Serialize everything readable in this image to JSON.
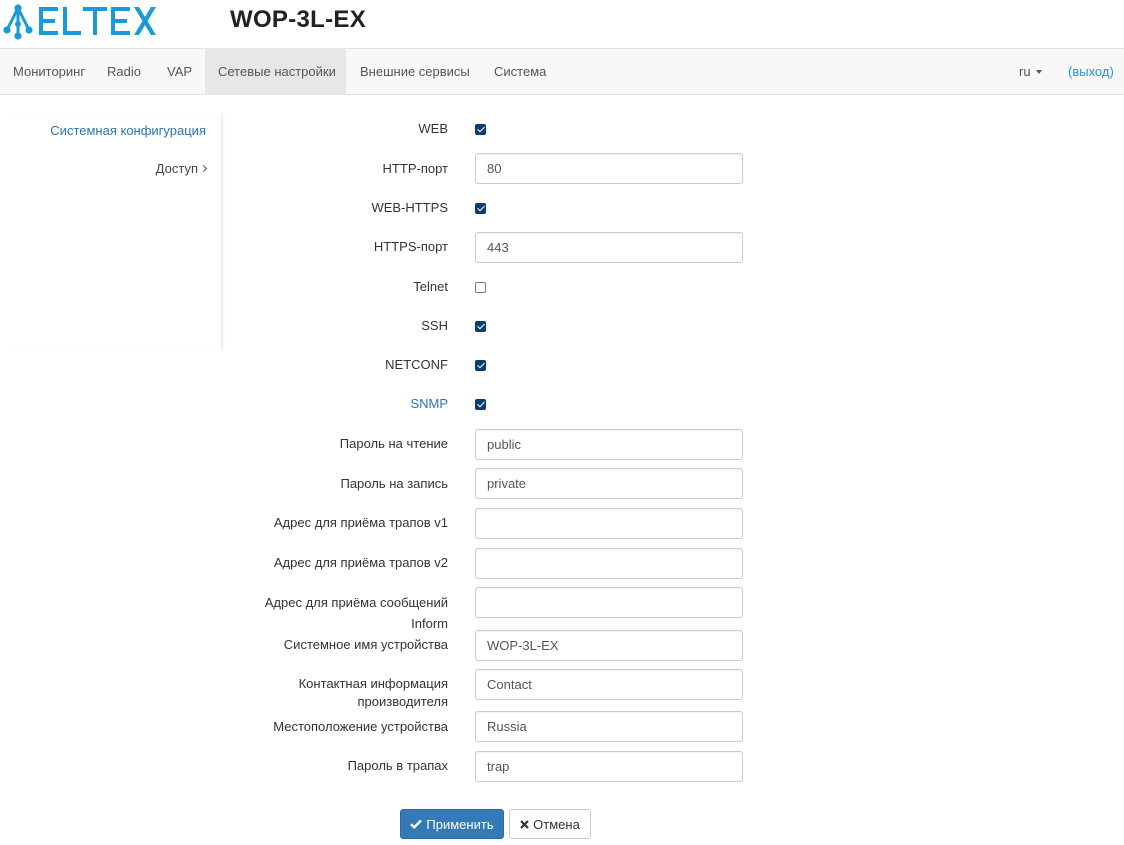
{
  "header": {
    "logo_text": "ELTEX",
    "model": "WOP-3L-EX",
    "brand_color": "#1a9bd7"
  },
  "nav": {
    "items": [
      {
        "label": "Мониторинг"
      },
      {
        "label": "Radio"
      },
      {
        "label": "VAP"
      },
      {
        "label": "Сетевые настройки",
        "active": true
      },
      {
        "label": "Внешние сервисы"
      },
      {
        "label": "Система"
      }
    ],
    "lang": "ru",
    "logout": "(выход)"
  },
  "sidebar": {
    "items": [
      {
        "label": "Системная конфигурация",
        "active": true
      },
      {
        "label": "Доступ",
        "icon": "chevron-right-icon"
      }
    ]
  },
  "form": {
    "web": {
      "label": "WEB",
      "checked": true
    },
    "http_port": {
      "label": "HTTP-порт",
      "value": "80"
    },
    "web_https": {
      "label": "WEB-HTTPS",
      "checked": true
    },
    "https_port": {
      "label": "HTTPS-порт",
      "value": "443"
    },
    "telnet": {
      "label": "Telnet",
      "checked": false
    },
    "ssh": {
      "label": "SSH",
      "checked": true
    },
    "netconf": {
      "label": "NETCONF",
      "checked": true
    },
    "snmp": {
      "label": "SNMP",
      "checked": true
    },
    "read_password": {
      "label": "Пароль на чтение",
      "value": "public"
    },
    "write_password": {
      "label": "Пароль на запись",
      "value": "private"
    },
    "trap_v1": {
      "label": "Адрес для приёма трапов v1",
      "value": ""
    },
    "trap_v2": {
      "label": "Адрес для приёма трапов v2",
      "value": ""
    },
    "inform": {
      "label_line1": "Адрес для приёма сообщений",
      "label_line2": "Inform",
      "value": ""
    },
    "sys_name": {
      "label": "Системное имя устройства",
      "value": "WOP-3L-EX"
    },
    "contact": {
      "label_line1": "Контактная информация",
      "label_line2": "производителя",
      "value": "Contact"
    },
    "location": {
      "label": "Местоположение устройства",
      "value": "Russia"
    },
    "trap_password": {
      "label": "Пароль в трапах",
      "value": "trap"
    }
  },
  "buttons": {
    "apply": {
      "label": "Применить",
      "icon": "check-icon"
    },
    "cancel": {
      "label": "Отмена",
      "icon": "close-icon"
    }
  }
}
